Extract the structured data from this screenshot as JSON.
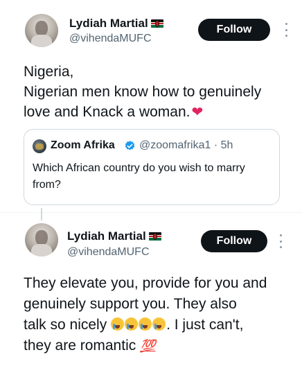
{
  "tweet1": {
    "name": "Lydiah Martial",
    "handle": "@vihendaMUFC",
    "flag_icon": "kenya-flag",
    "follow_label": "Follow",
    "text_lines": [
      "Nigeria,",
      "Nigerian men know how to genuinely",
      "love and Knack a woman."
    ],
    "emoji": "red-heart"
  },
  "quote": {
    "name": "Zoom Afrika",
    "handle": "@zoomafrika1",
    "separator": "·",
    "time": "5h",
    "text": "Which African country do you wish to marry from?"
  },
  "tweet2": {
    "name": "Lydiah Martial",
    "handle": "@vihendaMUFC",
    "flag_icon": "kenya-flag",
    "follow_label": "Follow",
    "text_lines": [
      "They elevate you, provide for you and",
      "genuinely support you. They also"
    ],
    "line3_before": "talk so nicely",
    "line3_after": ". I just can't,",
    "line4": "they are romantic",
    "emoji_hundred": "💯"
  },
  "colors": {
    "text": "#0f1419",
    "secondary": "#536471",
    "button_bg": "#0f1419",
    "border": "#cfd9de",
    "verified": "#1d9bf0",
    "heart": "#e0245e"
  }
}
